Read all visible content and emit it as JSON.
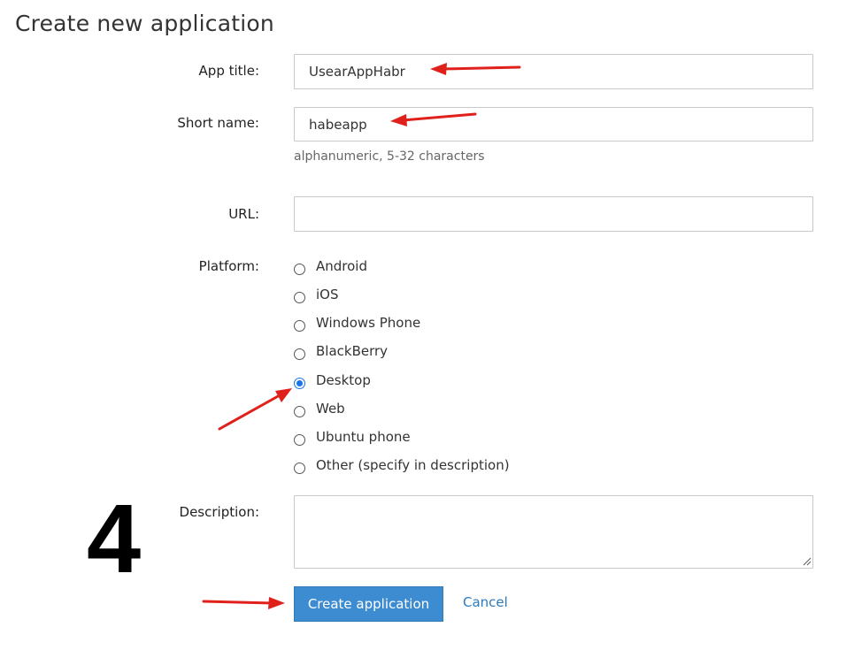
{
  "page": {
    "title": "Create new application"
  },
  "form": {
    "app_title": {
      "label": "App title:",
      "value": "UsearAppHabr"
    },
    "short_name": {
      "label": "Short name:",
      "value": "habeapp",
      "hint": "alphanumeric, 5-32 characters"
    },
    "url": {
      "label": "URL:",
      "value": ""
    },
    "platform": {
      "label": "Platform:",
      "options": [
        {
          "label": "Android",
          "checked": false
        },
        {
          "label": "iOS",
          "checked": false
        },
        {
          "label": "Windows Phone",
          "checked": false
        },
        {
          "label": "BlackBerry",
          "checked": false
        },
        {
          "label": "Desktop",
          "checked": true
        },
        {
          "label": "Web",
          "checked": false
        },
        {
          "label": "Ubuntu phone",
          "checked": false
        },
        {
          "label": "Other (specify in description)",
          "checked": false
        }
      ]
    },
    "description": {
      "label": "Description:",
      "value": ""
    }
  },
  "actions": {
    "create_label": "Create application",
    "cancel_label": "Cancel"
  },
  "annotation": {
    "step_number": "4",
    "arrow_color": "#e0201b"
  },
  "colors": {
    "primary_button": "#3d8bd0",
    "link": "#2b7bbf",
    "radio_checked": "#1a73e8"
  }
}
